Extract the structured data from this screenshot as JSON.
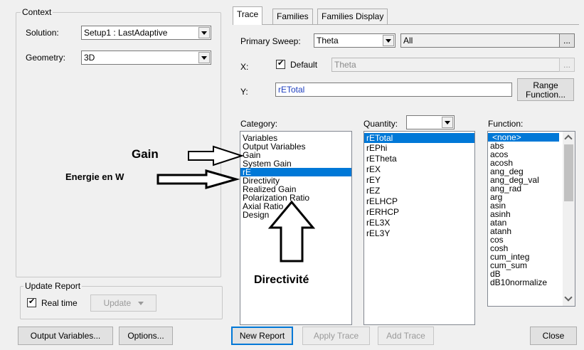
{
  "context": {
    "legend": "Context",
    "solution_label": "Solution:",
    "solution_value": "Setup1 : LastAdaptive",
    "geometry_label": "Geometry:",
    "geometry_value": "3D"
  },
  "update_report": {
    "legend": "Update Report",
    "realtime_label": "Real time",
    "realtime_checked": true,
    "update_label": "Update"
  },
  "tabs": [
    {
      "label": "Trace",
      "active": true
    },
    {
      "label": "Families",
      "active": false
    },
    {
      "label": "Families Display",
      "active": false
    }
  ],
  "primary_sweep": {
    "label": "Primary Sweep:",
    "value": "Theta",
    "range": "All",
    "ellipsis": "..."
  },
  "x_axis": {
    "label": "X:",
    "default_label": "Default",
    "default_checked": true,
    "value": "Theta",
    "ellipsis": "..."
  },
  "y_axis": {
    "label": "Y:",
    "value": "rETotal",
    "range_function_line1": "Range",
    "range_function_line2": "Function..."
  },
  "category": {
    "label": "Category:",
    "items": [
      "Variables",
      "Output Variables",
      "Gain",
      "System Gain",
      "rE",
      "Directivity",
      "Realized Gain",
      "Polarization Ratio",
      "Axial Ratio",
      "Design"
    ],
    "selected": "rE"
  },
  "quantity": {
    "label": "Quantity:",
    "items": [
      "rETotal",
      "rEPhi",
      "rETheta",
      "rEX",
      "rEY",
      "rEZ",
      "rELHCP",
      "rERHCP",
      "rEL3X",
      "rEL3Y"
    ],
    "selected": "rETotal"
  },
  "function": {
    "label": "Function:",
    "items": [
      "<none>",
      "abs",
      "acos",
      "acosh",
      "ang_deg",
      "ang_deg_val",
      "ang_rad",
      "arg",
      "asin",
      "asinh",
      "atan",
      "atanh",
      "cos",
      "cosh",
      "cum_integ",
      "cum_sum",
      "dB",
      "dB10normalize"
    ],
    "selected": "<none>"
  },
  "annotations": {
    "gain": "Gain",
    "energie": "Energie en W",
    "directivite": "Directivité"
  },
  "bottom": {
    "output_variables": "Output Variables...",
    "options": "Options...",
    "new_report": "New Report",
    "apply_trace": "Apply Trace",
    "add_trace": "Add Trace",
    "close": "Close"
  }
}
